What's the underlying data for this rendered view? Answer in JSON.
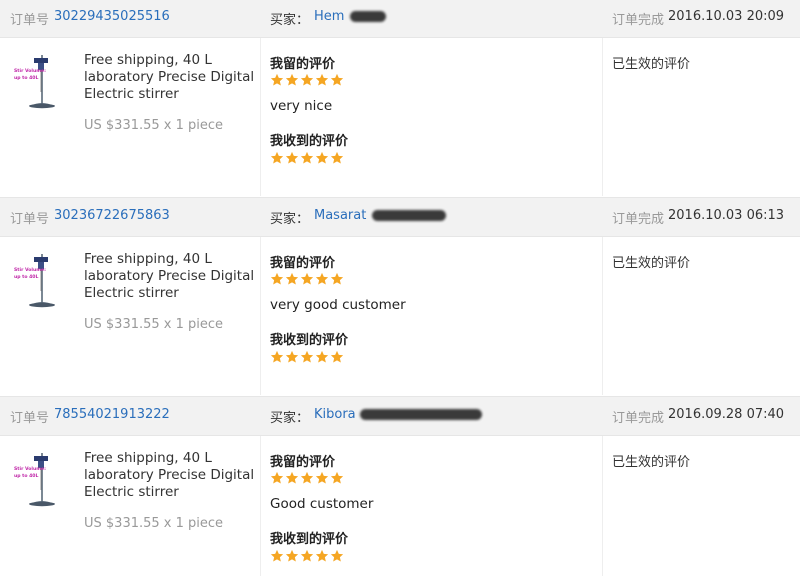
{
  "labels": {
    "order_no": "订单号",
    "buyer": "买家：",
    "status": "订单完成",
    "my_feedback": "我留的评价",
    "received_feedback": "我收到的评价",
    "feedback_status": "已生效的评价"
  },
  "colors": {
    "link": "#2a6ebb",
    "star": "#f5a623",
    "header_bg": "#f2f2f2"
  },
  "orders": [
    {
      "order_no": "30229435025516",
      "buyer_first": "Hem",
      "completed_at": "2016.10.03 20:09",
      "product": {
        "title": "Free shipping, 40 L laboratory Precise Digital Electric stirrer",
        "price": "US $331.55 x 1 piece",
        "thumb_text": "Stir Volume: up to 40L"
      },
      "my_rating": 5,
      "my_comment": "very nice",
      "received_rating": 5
    },
    {
      "order_no": "30236722675863",
      "buyer_first": "Masarat",
      "completed_at": "2016.10.03 06:13",
      "product": {
        "title": "Free shipping, 40 L laboratory Precise Digital Electric stirrer",
        "price": "US $331.55 x 1 piece",
        "thumb_text": "Stir Volume: up to 40L"
      },
      "my_rating": 5,
      "my_comment": "very good customer",
      "received_rating": 5
    },
    {
      "order_no": "78554021913222",
      "buyer_first": "Kibora",
      "completed_at": "2016.09.28 07:40",
      "product": {
        "title": "Free shipping, 40 L laboratory Precise Digital Electric stirrer",
        "price": "US $331.55 x 1 piece",
        "thumb_text": "Stir Volume: up to 40L"
      },
      "my_rating": 5,
      "my_comment": "Good customer",
      "received_rating": 5
    }
  ]
}
